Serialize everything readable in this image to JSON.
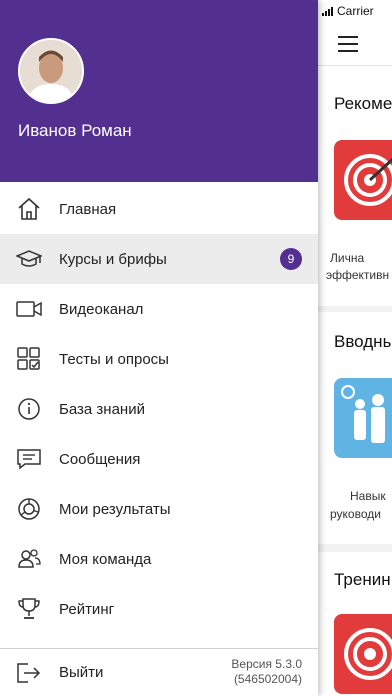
{
  "status_bar": {
    "carrier": "Carrier"
  },
  "user": {
    "name": "Иванов Роман"
  },
  "menu": [
    {
      "label": "Главная",
      "icon": "home-icon"
    },
    {
      "label": "Курсы и брифы",
      "icon": "graduation-cap-icon",
      "badge": "9",
      "active": true
    },
    {
      "label": "Видеоканал",
      "icon": "video-camera-icon"
    },
    {
      "label": "Тесты и опросы",
      "icon": "grid-check-icon"
    },
    {
      "label": "База знаний",
      "icon": "info-icon"
    },
    {
      "label": "Сообщения",
      "icon": "message-icon"
    },
    {
      "label": "Мои результаты",
      "icon": "chart-ring-icon"
    },
    {
      "label": "Моя команда",
      "icon": "team-icon"
    },
    {
      "label": "Рейтинг",
      "icon": "trophy-icon"
    }
  ],
  "footer": {
    "logout_label": "Выйти",
    "version_line1": "Версия 5.3.0",
    "version_line2": "(546502004)"
  },
  "background": {
    "section1_title": "Рекоме",
    "section1_caption_line1": "Лична",
    "section1_caption_line2": "эффективн",
    "section2_title": "Вводны",
    "section2_caption_line1": "Навык",
    "section2_caption_line2": "руководи",
    "section3_title": "Тренин"
  },
  "colors": {
    "header": "#532f8f",
    "accent": "#c8dc1f",
    "badge": "#532f8f"
  }
}
